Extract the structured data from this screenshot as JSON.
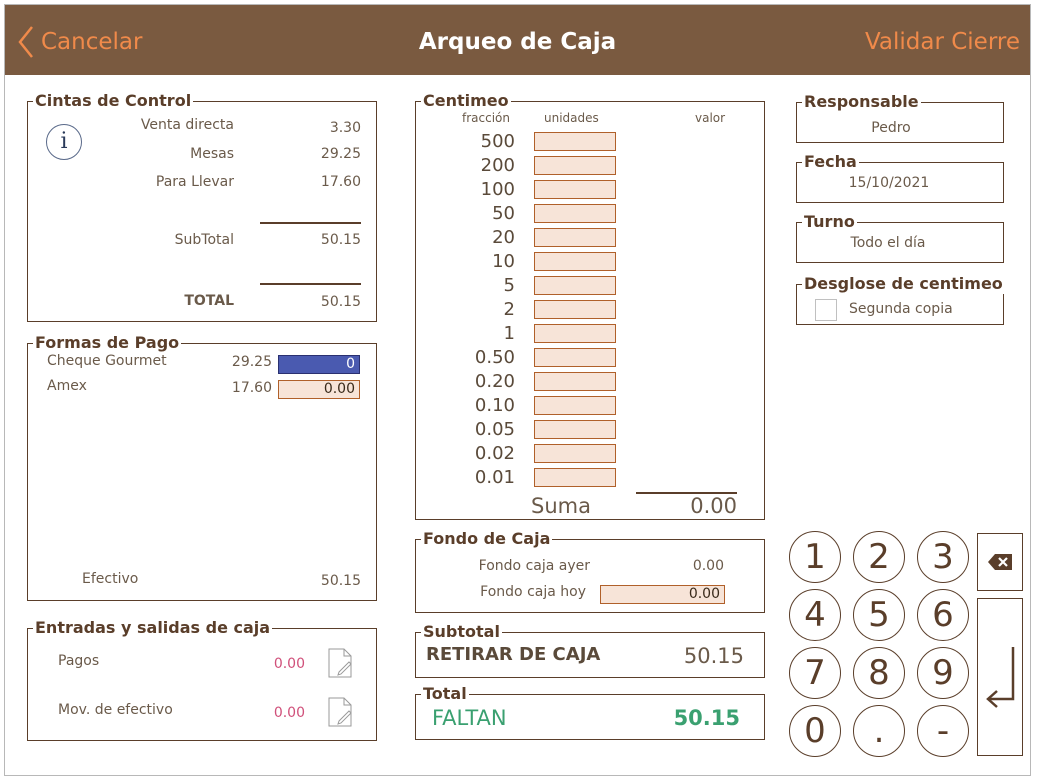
{
  "header": {
    "cancel": "Cancelar",
    "title": "Arqueo de Caja",
    "validate": "Validar Cierre"
  },
  "cintas": {
    "legend": "Cintas de Control",
    "rows": [
      {
        "label": "Venta directa",
        "value": "3.30"
      },
      {
        "label": "Mesas",
        "value": "29.25"
      },
      {
        "label": "Para Llevar",
        "value": "17.60"
      }
    ],
    "subtotal_label": "SubTotal",
    "subtotal_value": "50.15",
    "total_label": "TOTAL",
    "total_value": "50.15"
  },
  "formas": {
    "legend": "Formas de Pago",
    "rows": [
      {
        "label": "Cheque Gourmet",
        "amount": "29.25",
        "input": "0"
      },
      {
        "label": "Amex",
        "amount": "17.60",
        "input": "0.00"
      }
    ],
    "efectivo_label": "Efectivo",
    "efectivo_value": "50.15"
  },
  "entradas": {
    "legend": "Entradas y salidas de caja",
    "rows": [
      {
        "label": "Pagos",
        "value": "0.00"
      },
      {
        "label": "Mov. de efectivo",
        "value": "0.00"
      }
    ]
  },
  "centimeo": {
    "legend": "Centimeo",
    "col_fraccion": "fracción",
    "col_unidades": "unidades",
    "col_valor": "valor",
    "fractions": [
      "500",
      "200",
      "100",
      "50",
      "20",
      "10",
      "5",
      "2",
      "1",
      "0.50",
      "0.20",
      "0.10",
      "0.05",
      "0.02",
      "0.01"
    ],
    "suma_label": "Suma",
    "suma_value": "0.00"
  },
  "fondo": {
    "legend": "Fondo de Caja",
    "ayer_label": "Fondo caja ayer",
    "ayer_value": "0.00",
    "hoy_label": "Fondo caja hoy",
    "hoy_value": "0.00"
  },
  "subtotal": {
    "legend": "Subtotal",
    "label": "RETIRAR DE CAJA",
    "value": "50.15"
  },
  "total": {
    "legend": "Total",
    "label": "FALTAN",
    "value": "50.15"
  },
  "responsable": {
    "legend": "Responsable",
    "value": "Pedro"
  },
  "fecha": {
    "legend": "Fecha",
    "value": "15/10/2021"
  },
  "turno": {
    "legend": "Turno",
    "value": "Todo el día"
  },
  "desglose": {
    "legend": "Desglose de centimeo",
    "option": "Segunda copia"
  },
  "keypad": {
    "keys": [
      "1",
      "2",
      "3",
      "4",
      "5",
      "6",
      "7",
      "8",
      "9",
      "0",
      ".",
      "-"
    ]
  },
  "colors": {
    "header_bg": "#7a5a40",
    "accent": "#f08a4a",
    "faltan": "#3aa070",
    "pink": "#d0507a"
  }
}
